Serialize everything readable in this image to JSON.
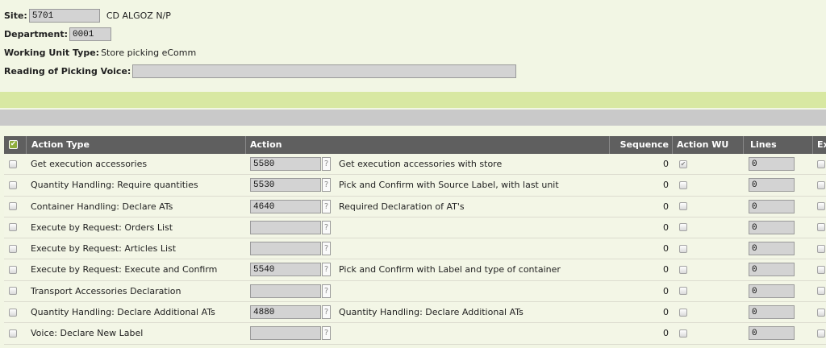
{
  "form": {
    "site_label": "Site:",
    "site_value": "5701",
    "site_name": "CD ALGOZ N/P",
    "department_label": "Department:",
    "department_value": "0001",
    "wut_label": "Working Unit Type:",
    "wut_value": "Store picking eComm",
    "reading_label": "Reading of Picking Voice:",
    "reading_value": ""
  },
  "table": {
    "header_check_glyph": "✔",
    "headers": {
      "action_type": "Action Type",
      "action": "Action",
      "sequence": "Sequence",
      "action_wu": "Action WU",
      "lines": "Lines",
      "ex": "Ex"
    },
    "rows": [
      {
        "type": "Get execution accessories",
        "code": "5580",
        "desc": "Get execution accessories with store",
        "seq": "0",
        "wu_checked": true,
        "lines": "0"
      },
      {
        "type": "Quantity Handling: Require quantities",
        "code": "5530",
        "desc": "Pick and Confirm with Source Label, with last unit",
        "seq": "0",
        "wu_checked": false,
        "lines": "0"
      },
      {
        "type": "Container Handling: Declare ATs",
        "code": "4640",
        "desc": "Required Declaration of AT's",
        "seq": "0",
        "wu_checked": false,
        "lines": "0"
      },
      {
        "type": "Execute by Request: Orders List",
        "code": "",
        "desc": "",
        "seq": "0",
        "wu_checked": false,
        "lines": "0"
      },
      {
        "type": "Execute by Request: Articles List",
        "code": "",
        "desc": "",
        "seq": "0",
        "wu_checked": false,
        "lines": "0"
      },
      {
        "type": "Execute by Request: Execute and Confirm",
        "code": "5540",
        "desc": "Pick and Confirm with Label and type of container",
        "seq": "0",
        "wu_checked": false,
        "lines": "0"
      },
      {
        "type": "Transport Accessories Declaration",
        "code": "",
        "desc": "",
        "seq": "0",
        "wu_checked": false,
        "lines": "0"
      },
      {
        "type": "Quantity Handling: Declare Additional ATs",
        "code": "4880",
        "desc": "Quantity Handling: Declare Additional ATs",
        "seq": "0",
        "wu_checked": false,
        "lines": "0"
      },
      {
        "type": "Voice: Declare New Label",
        "code": "",
        "desc": "",
        "seq": "0",
        "wu_checked": false,
        "lines": "0"
      }
    ]
  },
  "glyphs": {
    "check": "✔",
    "help": "?"
  },
  "colors": {
    "background": "#f2f6e4",
    "green_band": "#d8e8a2",
    "gray_band": "#c9c9c9",
    "header_bg": "#5f5f5f",
    "input_bg": "#d3d3d3"
  }
}
